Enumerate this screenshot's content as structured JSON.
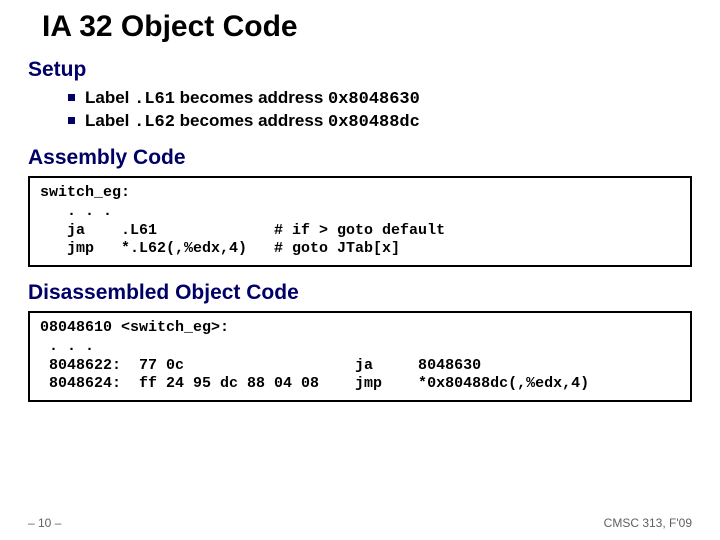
{
  "title": "IA 32 Object Code",
  "setup": {
    "heading": "Setup",
    "b1_pre": "Label ",
    "b1_code": ".L61",
    "b1_mid": " becomes address ",
    "b1_addr": "0x8048630",
    "b2_pre": "Label ",
    "b2_code": ".L62",
    "b2_mid": " becomes address ",
    "b2_addr": "0x80488dc"
  },
  "asm": {
    "heading": "Assembly Code",
    "code": "switch_eg:\n   . . .\n   ja    .L61             # if > goto default\n   jmp   *.L62(,%edx,4)   # goto JTab[x]"
  },
  "disasm": {
    "heading": "Disassembled Object Code",
    "code": "08048610 <switch_eg>:\n . . .\n 8048622:  77 0c                   ja     8048630\n 8048624:  ff 24 95 dc 88 04 08    jmp    *0x80488dc(,%edx,4)"
  },
  "footer": {
    "left": "– 10 –",
    "right": "CMSC 313, F'09"
  }
}
